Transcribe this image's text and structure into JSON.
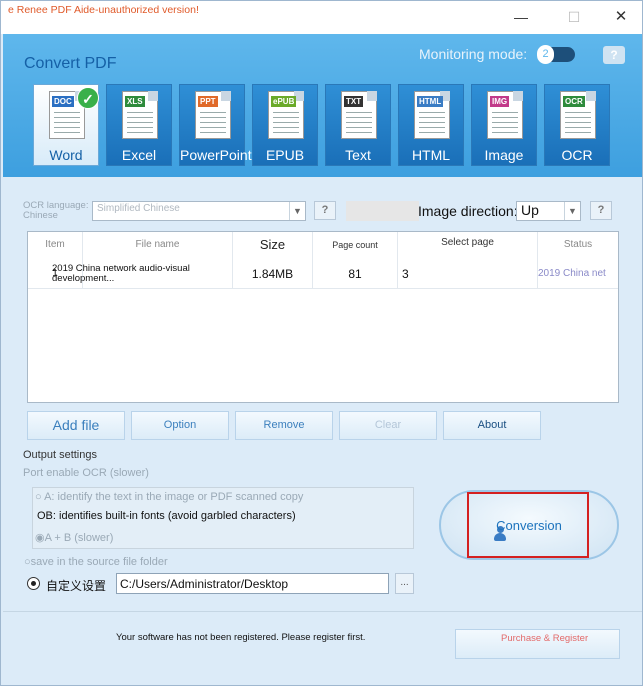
{
  "window": {
    "title": "e Renee PDF Aide-unauthorized version!",
    "minimize_glyph": "—",
    "maximize_glyph": "☐",
    "close_glyph": "✕"
  },
  "header": {
    "convert_title": "Convert PDF",
    "monitoring_label": "Monitoring mode:",
    "monitoring_toggle_value": "2",
    "help_glyph": "?"
  },
  "formats": [
    {
      "tag": "DOC",
      "label": "Word",
      "active": true,
      "tag_color": "#2b6fc2"
    },
    {
      "tag": "XLS",
      "label": "Excel",
      "active": false,
      "tag_color": "#2e8b3c"
    },
    {
      "tag": "PPT",
      "label": "PowerPoint",
      "active": false,
      "tag_color": "#e06a2a"
    },
    {
      "tag": "ePUB",
      "label": "EPUB",
      "active": false,
      "tag_color": "#6aaa2a"
    },
    {
      "tag": "TXT",
      "label": "Text",
      "active": false,
      "tag_color": "#333333"
    },
    {
      "tag": "HTML",
      "label": "HTML",
      "active": false,
      "tag_color": "#3a7cc4"
    },
    {
      "tag": "IMG",
      "label": "Image",
      "active": false,
      "tag_color": "#c23a8a"
    },
    {
      "tag": "OCR",
      "label": "OCR",
      "active": false,
      "tag_color": "#2e8b3c"
    }
  ],
  "ocr": {
    "language_label": "OCR language: Chinese",
    "language_value": "Simplified Chinese",
    "image_direction_label": "Image direction:",
    "image_direction_value": "Up"
  },
  "table": {
    "headers": [
      "Item",
      "File name",
      "Size",
      "Page count",
      "Select page",
      "Status"
    ],
    "rows": [
      {
        "item": "1",
        "file_name": "2019 China network audio-visual development...",
        "size": "1.84MB",
        "page_count": "81",
        "select_page": "3",
        "status": "2019 China net"
      }
    ]
  },
  "buttons": {
    "add_file": "Add file",
    "option": "Option",
    "remove": "Remove",
    "clear": "Clear",
    "about": "About"
  },
  "output": {
    "settings_label": "Output settings",
    "port_ocr_label": "Port enable OCR (slower)",
    "option_a": "○ A: identify the text in the image or PDF scanned copy",
    "option_b": "OB: identifies built-in fonts (avoid garbled characters)",
    "option_ab": "◉A + B (slower)",
    "save_source_label": "○save in the source file folder",
    "custom_label": "自定义设置",
    "path": "C:/Users/Administrator/Desktop",
    "browse_label": "..."
  },
  "conversion": {
    "label": "Conversion"
  },
  "footer": {
    "register_notice": "Your software has not been registered. Please register first.",
    "purchase_label": "Purchase & Register"
  }
}
